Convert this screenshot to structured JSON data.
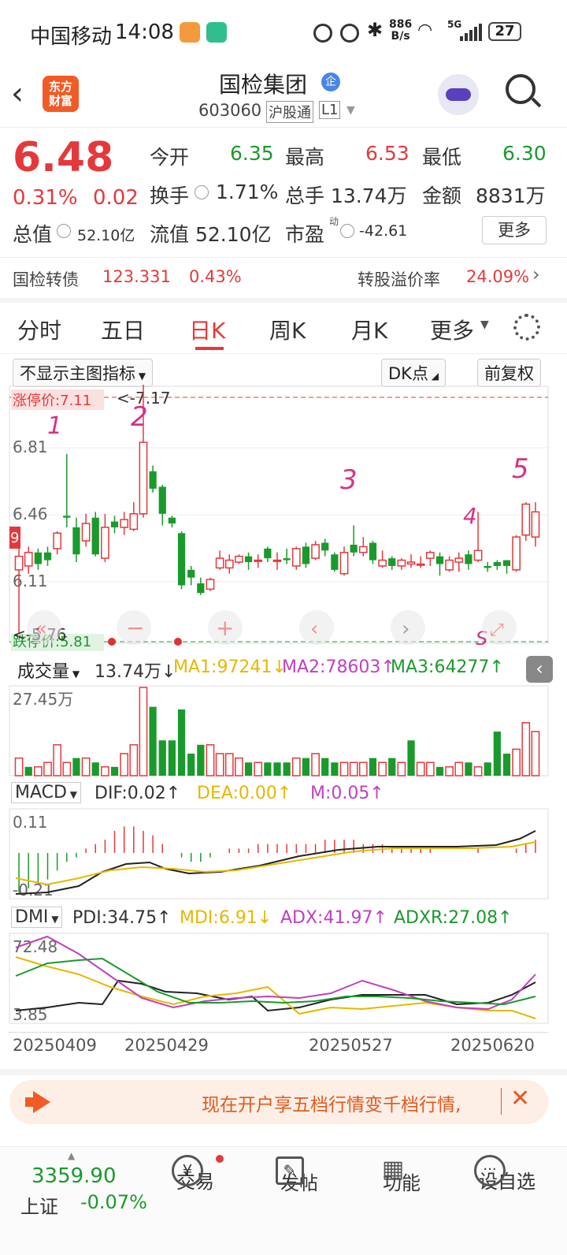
{
  "status_bar": {
    "carrier": "中国移动",
    "time": "14:08",
    "net_speed_top": "886",
    "net_speed_unit": "B/s",
    "signal": "5G",
    "battery": "27"
  },
  "header": {
    "logo_line1": "东方",
    "logo_line2": "财富",
    "name": "国检集团",
    "badge": "企",
    "code": "603060",
    "market": "沪股通",
    "level": "L1"
  },
  "quote": {
    "price": "6.48",
    "change_pct": "0.31%",
    "change": "0.02",
    "open_label": "今开",
    "open": "6.35",
    "high_label": "最高",
    "high": "6.53",
    "low_label": "最低",
    "low": "6.30",
    "turnover_label": "换手",
    "turnover": "1.71%",
    "volume_label": "总手",
    "volume": "13.74万",
    "amount_label": "金额",
    "amount": "8831万",
    "mcap_label": "总值",
    "mcap": "52.10亿",
    "float_label": "流值",
    "float": "52.10亿",
    "pe_label": "市盈",
    "pe_sup": "动",
    "pe": "-42.61",
    "more": "更多"
  },
  "bond": {
    "name": "国检转债",
    "price": "123.331",
    "pct": "0.43%",
    "premium_label": "转股溢价率",
    "premium": "24.09%"
  },
  "tabs": [
    "分时",
    "五日",
    "日K",
    "周K",
    "月K",
    "更多"
  ],
  "chart_toolbar": {
    "indicator": "不显示主图指标",
    "dk": "DK点",
    "adjust": "前复权"
  },
  "chart_data": [
    {
      "type": "candlestick",
      "title": "日K",
      "y_ticks": [
        "6.81",
        "6.46",
        "6.11"
      ],
      "ylim": [
        5.8,
        7.13
      ],
      "limit_up_label": "涨停价:7.11",
      "limit_down_label": "跌停价:5.81",
      "high_marker": "7.17",
      "low_marker": "5.76",
      "annotations": [
        "1",
        "2",
        "3",
        "4",
        "5",
        "S"
      ],
      "candles": [
        [
          6.18,
          6.25,
          6.35,
          5.82
        ],
        [
          6.2,
          6.27,
          6.3,
          6.16
        ],
        [
          6.27,
          6.21,
          6.29,
          6.18
        ],
        [
          6.27,
          6.23,
          6.3,
          6.2
        ],
        [
          6.29,
          6.37,
          6.38,
          6.26
        ],
        [
          6.46,
          6.45,
          6.78,
          6.4
        ],
        [
          6.4,
          6.26,
          6.45,
          6.22
        ],
        [
          6.33,
          6.42,
          6.47,
          6.3
        ],
        [
          6.45,
          6.26,
          6.48,
          6.25
        ],
        [
          6.24,
          6.4,
          6.47,
          6.22
        ],
        [
          6.43,
          6.4,
          6.46,
          6.37
        ],
        [
          6.4,
          6.44,
          6.48,
          6.36
        ],
        [
          6.39,
          6.47,
          6.53,
          6.38
        ],
        [
          6.47,
          6.84,
          7.17,
          6.45
        ],
        [
          6.69,
          6.6,
          6.72,
          6.58
        ],
        [
          6.61,
          6.47,
          6.62,
          6.41
        ],
        [
          6.45,
          6.42,
          6.46,
          6.4
        ],
        [
          6.37,
          6.1,
          6.38,
          6.08
        ],
        [
          6.18,
          6.14,
          6.2,
          6.1
        ],
        [
          6.11,
          6.06,
          6.14,
          6.05
        ],
        [
          6.08,
          6.13,
          6.14,
          6.07
        ],
        [
          6.19,
          6.24,
          6.28,
          6.18
        ],
        [
          6.19,
          6.23,
          6.26,
          6.16
        ],
        [
          6.22,
          6.25,
          6.26,
          6.21
        ],
        [
          6.25,
          6.22,
          6.27,
          6.18
        ],
        [
          6.23,
          6.23,
          6.26,
          6.19
        ],
        [
          6.29,
          6.24,
          6.3,
          6.22
        ],
        [
          6.23,
          6.23,
          6.27,
          6.18
        ],
        [
          6.24,
          6.23,
          6.29,
          6.21
        ],
        [
          6.2,
          6.29,
          6.3,
          6.18
        ],
        [
          6.3,
          6.21,
          6.32,
          6.19
        ],
        [
          6.24,
          6.31,
          6.33,
          6.23
        ],
        [
          6.32,
          6.28,
          6.34,
          6.25
        ],
        [
          6.26,
          6.18,
          6.27,
          6.17
        ],
        [
          6.16,
          6.27,
          6.3,
          6.15
        ],
        [
          6.31,
          6.27,
          6.41,
          6.25
        ],
        [
          6.27,
          6.3,
          6.35,
          6.25
        ],
        [
          6.32,
          6.23,
          6.33,
          6.21
        ],
        [
          6.2,
          6.23,
          6.28,
          6.19
        ],
        [
          6.24,
          6.2,
          6.25,
          6.18
        ],
        [
          6.2,
          6.23,
          6.24,
          6.18
        ],
        [
          6.21,
          6.22,
          6.26,
          6.19
        ],
        [
          6.21,
          6.21,
          6.25,
          6.19
        ],
        [
          6.24,
          6.27,
          6.28,
          6.2
        ],
        [
          6.25,
          6.21,
          6.27,
          6.15
        ],
        [
          6.18,
          6.23,
          6.25,
          6.17
        ],
        [
          6.22,
          6.24,
          6.27,
          6.17
        ],
        [
          6.26,
          6.21,
          6.28,
          6.18
        ],
        [
          6.23,
          6.28,
          6.48,
          6.22
        ],
        [
          6.2,
          6.19,
          6.22,
          6.17
        ],
        [
          6.22,
          6.2,
          6.23,
          6.18
        ],
        [
          6.23,
          6.2,
          6.23,
          6.16
        ],
        [
          6.18,
          6.35,
          6.36,
          6.17
        ],
        [
          6.36,
          6.52,
          6.53,
          6.33
        ],
        [
          6.35,
          6.48,
          6.53,
          6.3
        ]
      ]
    },
    {
      "type": "bar",
      "title": "成交量",
      "label": "成交量",
      "current": "13.74万",
      "y_tick": "27.45万",
      "ma1": "MA1:97241",
      "ma2": "MA2:78603",
      "ma3": "MA3:64277",
      "values": [
        0.2,
        0.1,
        0.1,
        0.15,
        0.35,
        0.15,
        0.2,
        0.2,
        0.15,
        0.1,
        0.1,
        0.25,
        0.35,
        1.0,
        0.78,
        0.4,
        0.4,
        0.75,
        0.25,
        0.35,
        0.35,
        0.25,
        0.25,
        0.2,
        0.15,
        0.15,
        0.15,
        0.15,
        0.15,
        0.2,
        0.2,
        0.25,
        0.2,
        0.15,
        0.15,
        0.15,
        0.15,
        0.2,
        0.15,
        0.2,
        0.15,
        0.4,
        0.15,
        0.15,
        0.1,
        0.1,
        0.15,
        0.15,
        0.1,
        0.15,
        0.5,
        0.25,
        0.3,
        0.6,
        0.5
      ],
      "up": [
        1,
        0,
        1,
        1,
        1,
        1,
        0,
        1,
        0,
        1,
        0,
        1,
        1,
        1,
        0,
        0,
        0,
        0,
        0,
        0,
        1,
        1,
        1,
        1,
        0,
        1,
        0,
        0,
        0,
        1,
        0,
        1,
        0,
        0,
        1,
        1,
        1,
        0,
        1,
        0,
        1,
        0,
        1,
        1,
        0,
        1,
        1,
        0,
        1,
        0,
        0,
        0,
        1,
        1,
        1
      ]
    },
    {
      "type": "line",
      "title": "MACD",
      "label": "MACD",
      "dif": "DIF:0.02",
      "dea": "DEA:0.00",
      "m": "M:0.05",
      "y_ticks": [
        "0.11",
        "-0.21"
      ]
    },
    {
      "type": "line",
      "title": "DMI",
      "label": "DMI",
      "pdi": "PDI:34.75",
      "mdi": "MDI:6.91",
      "adx": "ADX:41.97",
      "adxr": "ADXR:27.08",
      "y_ticks": [
        "72.48",
        "3.85"
      ]
    }
  ],
  "x_dates": [
    "20250409",
    "20250429",
    "20250527",
    "20250620"
  ],
  "banner": {
    "text": "现在开户享五档行情变千档行情,"
  },
  "bottom_nav": {
    "index_value": "3359.90",
    "index_name": "上证",
    "index_pct": "-0.07%",
    "items": [
      "交易",
      "发帖",
      "功能",
      "设自选"
    ]
  },
  "colors": {
    "up": "#e4393c",
    "down": "#1a9a2c",
    "ma1": "#e6b800",
    "ma2": "#c040c0",
    "ma3": "#1a9a2c"
  }
}
